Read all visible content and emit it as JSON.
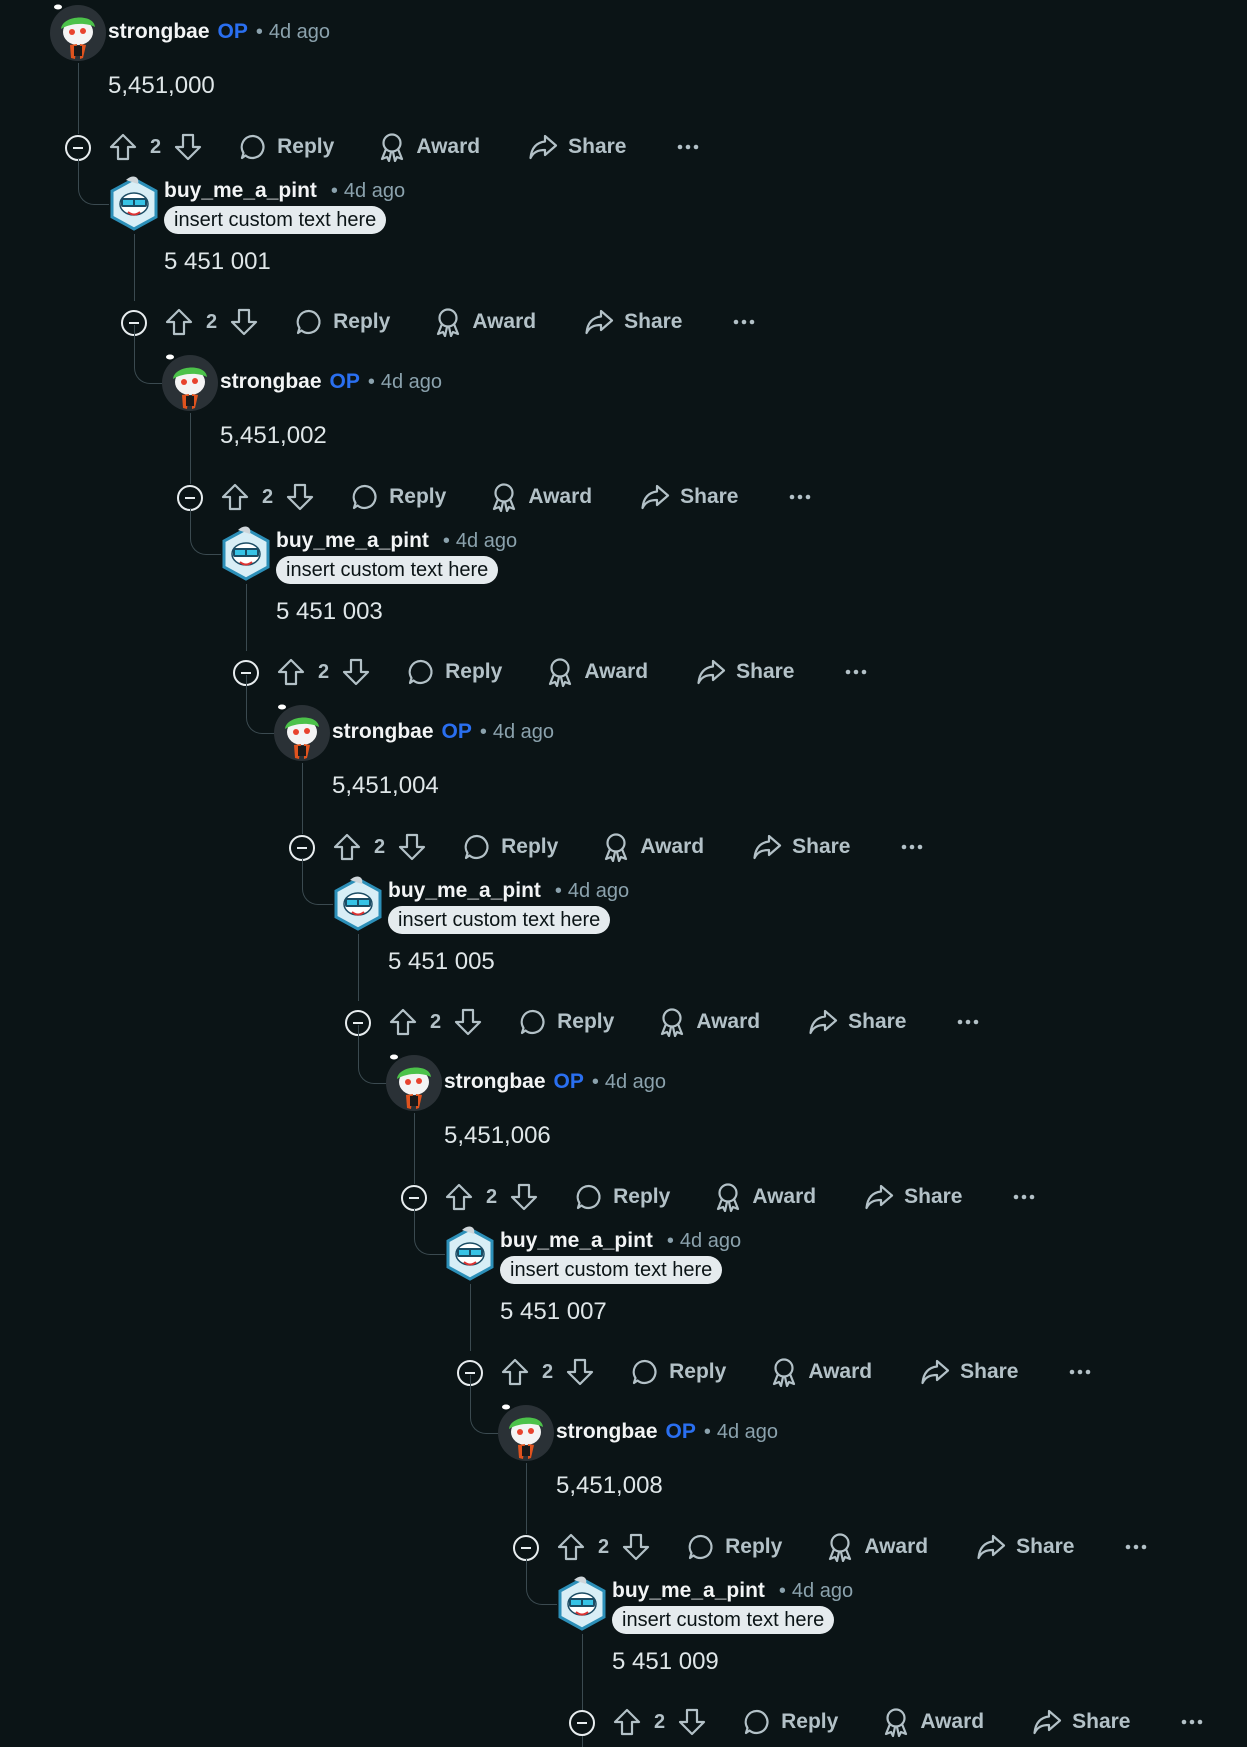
{
  "ui": {
    "reply_label": "Reply",
    "award_label": "Award",
    "share_label": "Share",
    "more_label": "···"
  },
  "colors": {
    "background": "#0b1416",
    "op_badge": "#2a6ff0",
    "flair_bg": "#e5ebee"
  },
  "comments": [
    {
      "author": "strongbae",
      "op_badge": "OP",
      "sep": "•",
      "time": "4d ago",
      "body": "5,451,000",
      "votes": "2",
      "avatar_icon": "snoo-green-hat-avatar"
    },
    {
      "author": "buy_me_a_pint",
      "sep": "•",
      "time": "4d ago",
      "flair": "insert custom text here",
      "body": "5 451 001",
      "votes": "2",
      "avatar_icon": "snoo-hexagon-visor-avatar"
    },
    {
      "author": "strongbae",
      "op_badge": "OP",
      "sep": "•",
      "time": "4d ago",
      "body": "5,451,002",
      "votes": "2",
      "avatar_icon": "snoo-green-hat-avatar"
    },
    {
      "author": "buy_me_a_pint",
      "sep": "•",
      "time": "4d ago",
      "flair": "insert custom text here",
      "body": "5 451 003",
      "votes": "2",
      "avatar_icon": "snoo-hexagon-visor-avatar"
    },
    {
      "author": "strongbae",
      "op_badge": "OP",
      "sep": "•",
      "time": "4d ago",
      "body": "5,451,004",
      "votes": "2",
      "avatar_icon": "snoo-green-hat-avatar"
    },
    {
      "author": "buy_me_a_pint",
      "sep": "•",
      "time": "4d ago",
      "flair": "insert custom text here",
      "body": "5 451 005",
      "votes": "2",
      "avatar_icon": "snoo-hexagon-visor-avatar"
    },
    {
      "author": "strongbae",
      "op_badge": "OP",
      "sep": "•",
      "time": "4d ago",
      "body": "5,451,006",
      "votes": "2",
      "avatar_icon": "snoo-green-hat-avatar"
    },
    {
      "author": "buy_me_a_pint",
      "sep": "•",
      "time": "4d ago",
      "flair": "insert custom text here",
      "body": "5 451 007",
      "votes": "2",
      "avatar_icon": "snoo-hexagon-visor-avatar"
    },
    {
      "author": "strongbae",
      "op_badge": "OP",
      "sep": "•",
      "time": "4d ago",
      "body": "5,451,008",
      "votes": "2",
      "avatar_icon": "snoo-green-hat-avatar"
    },
    {
      "author": "buy_me_a_pint",
      "sep": "•",
      "time": "4d ago",
      "flair": "insert custom text here",
      "body": "5 451 009",
      "votes": "2",
      "avatar_icon": "snoo-hexagon-visor-avatar"
    }
  ]
}
